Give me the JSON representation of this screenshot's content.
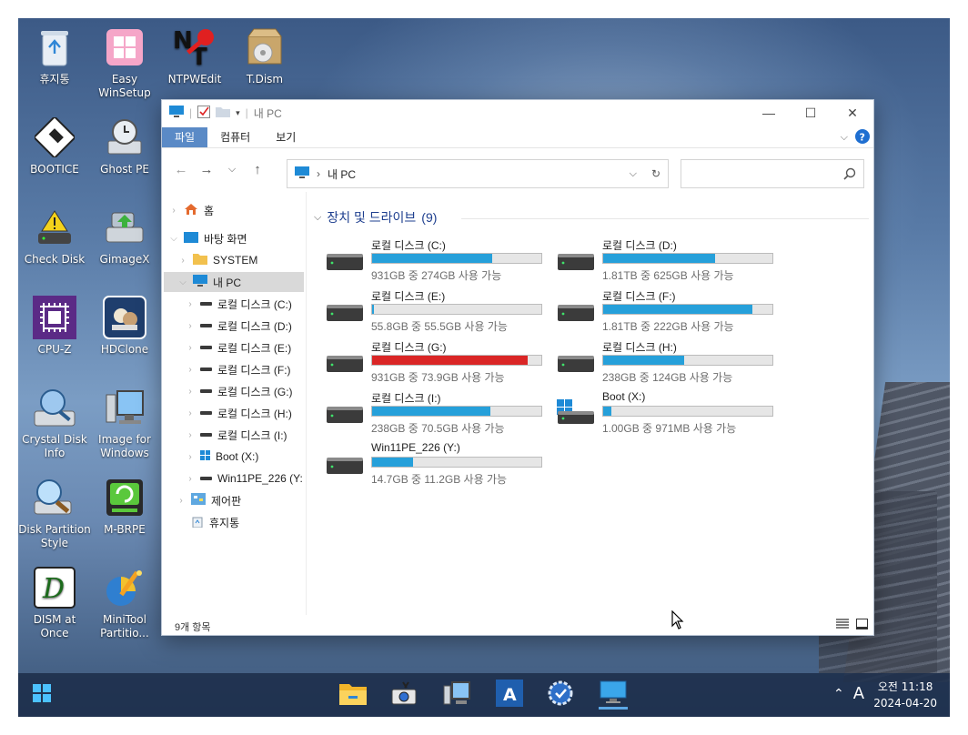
{
  "desktop": {
    "icons": [
      {
        "label": "휴지통",
        "icon": "recycle-bin-icon"
      },
      {
        "label": "Easy WinSetup",
        "icon": "windows-setup-icon"
      },
      {
        "label": "NTPWEdit",
        "icon": "ntpwedit-key-icon"
      },
      {
        "label": "T.Dism",
        "icon": "disc-box-icon"
      },
      {
        "label": "BOOTICE",
        "icon": "floppy-icon"
      },
      {
        "label": "Ghost PE",
        "icon": "ghost-drive-icon"
      },
      {
        "label": "Check Disk",
        "icon": "warning-drive-icon"
      },
      {
        "label": "GimageX",
        "icon": "gimagex-icon"
      },
      {
        "label": "CPU-Z",
        "icon": "cpu-icon"
      },
      {
        "label": "HDClone",
        "icon": "hdclone-icon"
      },
      {
        "label": "Crystal Disk Info",
        "icon": "crystal-disk-icon"
      },
      {
        "label": "Image for Windows",
        "icon": "image-for-windows-icon"
      },
      {
        "label": "Disk Partition Style",
        "icon": "disk-partition-icon"
      },
      {
        "label": "M-BRPE",
        "icon": "mbrpe-icon"
      },
      {
        "label": "DISM at Once",
        "icon": "dism-icon"
      },
      {
        "label": "MiniTool Partitio...",
        "icon": "minitool-icon"
      }
    ]
  },
  "explorer": {
    "title": "내 PC",
    "ribbon_tabs": [
      "파일",
      "컴퓨터",
      "보기"
    ],
    "address_path": "내 PC",
    "search_placeholder": "",
    "group_header": "장치 및 드라이브",
    "group_count": "(9)",
    "status_count": "9개 항목",
    "sidebar": [
      {
        "label": "홈",
        "icon": "home-icon"
      },
      {
        "label": "바탕 화면",
        "icon": "desktop-icon"
      },
      {
        "label": "SYSTEM",
        "icon": "folder-icon"
      },
      {
        "label": "내 PC",
        "icon": "pc-icon"
      },
      {
        "label": "로컬 디스크 (C:)",
        "icon": "drive-icon"
      },
      {
        "label": "로컬 디스크 (D:)",
        "icon": "drive-icon"
      },
      {
        "label": "로컬 디스크 (E:)",
        "icon": "drive-icon"
      },
      {
        "label": "로컬 디스크 (F:)",
        "icon": "drive-icon"
      },
      {
        "label": "로컬 디스크 (G:)",
        "icon": "drive-icon"
      },
      {
        "label": "로컬 디스크 (H:)",
        "icon": "drive-icon"
      },
      {
        "label": "로컬 디스크 (I:)",
        "icon": "drive-icon"
      },
      {
        "label": "Boot (X:)",
        "icon": "windows-drive-icon"
      },
      {
        "label": "Win11PE_226 (Y:",
        "icon": "drive-icon"
      },
      {
        "label": "제어판",
        "icon": "control-panel-icon"
      },
      {
        "label": "휴지통",
        "icon": "recycle-bin-icon"
      }
    ],
    "drives": [
      {
        "name": "로컬 디스크 (C:)",
        "free_text": "931GB 중 274GB 사용 가능",
        "used_fraction": 0.71,
        "color": "#26a0da"
      },
      {
        "name": "로컬 디스크 (D:)",
        "free_text": "1.81TB 중 625GB 사용 가능",
        "used_fraction": 0.66,
        "color": "#26a0da"
      },
      {
        "name": "로컬 디스크 (E:)",
        "free_text": "55.8GB 중 55.5GB 사용 가능",
        "used_fraction": 0.01,
        "color": "#26a0da"
      },
      {
        "name": "로컬 디스크 (F:)",
        "free_text": "1.81TB 중 222GB 사용 가능",
        "used_fraction": 0.88,
        "color": "#26a0da"
      },
      {
        "name": "로컬 디스크 (G:)",
        "free_text": "931GB 중 73.9GB 사용 가능",
        "used_fraction": 0.92,
        "color": "#da2626"
      },
      {
        "name": "로컬 디스크 (H:)",
        "free_text": "238GB 중 124GB 사용 가능",
        "used_fraction": 0.48,
        "color": "#26a0da"
      },
      {
        "name": "로컬 디스크 (I:)",
        "free_text": "238GB 중 70.5GB 사용 가능",
        "used_fraction": 0.7,
        "color": "#26a0da"
      },
      {
        "name": "Boot (X:)",
        "free_text": "1.00GB 중 971MB 사용 가능",
        "used_fraction": 0.05,
        "color": "#26a0da"
      },
      {
        "name": "Win11PE_226 (Y:)",
        "free_text": "14.7GB 중 11.2GB 사용 가능",
        "used_fraction": 0.24,
        "color": "#26a0da"
      }
    ]
  },
  "taskbar": {
    "time": "오전 11:18",
    "date": "2024-04-20",
    "ime": "A"
  }
}
